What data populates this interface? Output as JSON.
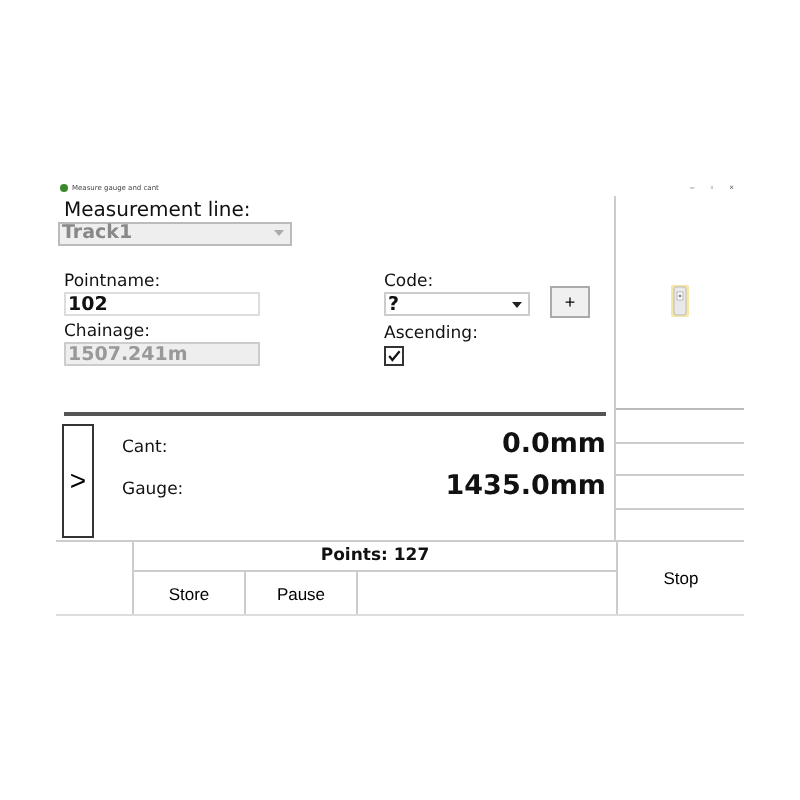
{
  "window": {
    "title": "Measure gauge and cant",
    "controls": [
      "–",
      "▫",
      "×"
    ]
  },
  "form": {
    "measurement_line": {
      "label": "Measurement line:",
      "value": "Track1",
      "disabled": true
    },
    "pointname": {
      "label": "Pointname:",
      "value": "102"
    },
    "code": {
      "label": "Code:",
      "value": "?",
      "add_button": "+"
    },
    "chainage": {
      "label": "Chainage:",
      "value": "1507.241m",
      "disabled": true
    },
    "ascending": {
      "label": "Ascending:",
      "checked": true
    }
  },
  "readings": {
    "expand_button": ">",
    "rows": [
      {
        "label": "Cant:",
        "value": "0.0mm"
      },
      {
        "label": "Gauge:",
        "value": "1435.0mm"
      }
    ]
  },
  "footer": {
    "points": "Points: 127",
    "buttons": [
      "Store",
      "Pause"
    ]
  },
  "side": {
    "stop_button": "Stop"
  }
}
